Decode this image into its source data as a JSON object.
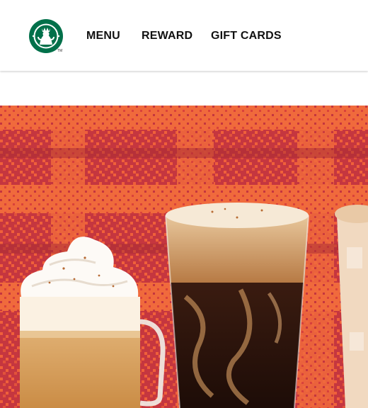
{
  "header": {
    "logo_label": "",
    "trademark": "TM",
    "nav": [
      {
        "id": "menu",
        "label": "MENU"
      },
      {
        "id": "reward",
        "label": "REWARD"
      },
      {
        "id": "gift-cards",
        "label": "GIFT CARDS"
      }
    ]
  },
  "hero": {
    "background_colors": {
      "base": "#c5363f",
      "plaid": "#f0603a",
      "dark": "#a82a33"
    },
    "drinks": [
      "whipped-latte",
      "cold-brew-glass",
      "iced-latte"
    ]
  }
}
